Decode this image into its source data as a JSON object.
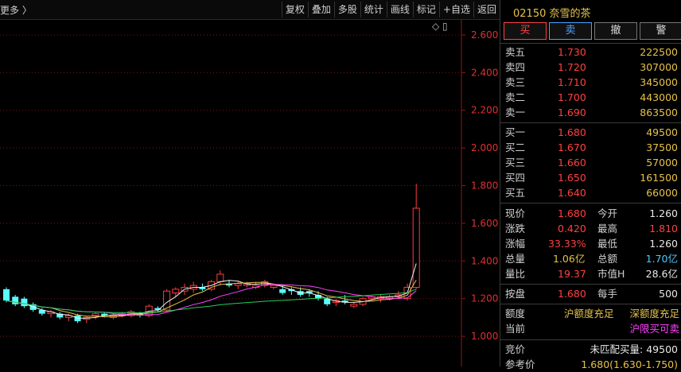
{
  "toolbar": {
    "more": "更多 〉",
    "buttons": [
      "复权",
      "叠加",
      "多股",
      "统计",
      "画线",
      "标记",
      "+自选",
      "返回"
    ]
  },
  "chart_icons": "◇ ▯",
  "chart_data": {
    "type": "candlestick",
    "y_ticks": [
      "2.600",
      "2.400",
      "2.200",
      "2.000",
      "1.800",
      "1.600",
      "1.400",
      "1.200",
      "1.000"
    ],
    "y_range": [
      0.84,
      2.68
    ],
    "candles": [
      {
        "o": 1.25,
        "h": 1.26,
        "l": 1.18,
        "c": 1.19
      },
      {
        "o": 1.21,
        "h": 1.22,
        "l": 1.16,
        "c": 1.17
      },
      {
        "o": 1.2,
        "h": 1.21,
        "l": 1.15,
        "c": 1.16
      },
      {
        "o": 1.17,
        "h": 1.18,
        "l": 1.13,
        "c": 1.14
      },
      {
        "o": 1.14,
        "h": 1.15,
        "l": 1.11,
        "c": 1.12
      },
      {
        "o": 1.12,
        "h": 1.14,
        "l": 1.1,
        "c": 1.13
      },
      {
        "o": 1.12,
        "h": 1.13,
        "l": 1.09,
        "c": 1.1
      },
      {
        "o": 1.1,
        "h": 1.12,
        "l": 1.08,
        "c": 1.11
      },
      {
        "o": 1.11,
        "h": 1.12,
        "l": 1.07,
        "c": 1.08
      },
      {
        "o": 1.09,
        "h": 1.11,
        "l": 1.07,
        "c": 1.1
      },
      {
        "o": 1.11,
        "h": 1.13,
        "l": 1.09,
        "c": 1.12
      },
      {
        "o": 1.12,
        "h": 1.13,
        "l": 1.1,
        "c": 1.11
      },
      {
        "o": 1.1,
        "h": 1.12,
        "l": 1.09,
        "c": 1.11
      },
      {
        "o": 1.11,
        "h": 1.13,
        "l": 1.1,
        "c": 1.12
      },
      {
        "o": 1.11,
        "h": 1.14,
        "l": 1.1,
        "c": 1.13
      },
      {
        "o": 1.12,
        "h": 1.13,
        "l": 1.1,
        "c": 1.11
      },
      {
        "o": 1.11,
        "h": 1.17,
        "l": 1.1,
        "c": 1.16
      },
      {
        "o": 1.15,
        "h": 1.16,
        "l": 1.13,
        "c": 1.14
      },
      {
        "o": 1.14,
        "h": 1.25,
        "l": 1.13,
        "c": 1.24
      },
      {
        "o": 1.23,
        "h": 1.26,
        "l": 1.21,
        "c": 1.25
      },
      {
        "o": 1.24,
        "h": 1.28,
        "l": 1.22,
        "c": 1.26
      },
      {
        "o": 1.25,
        "h": 1.29,
        "l": 1.23,
        "c": 1.27
      },
      {
        "o": 1.26,
        "h": 1.28,
        "l": 1.24,
        "c": 1.25
      },
      {
        "o": 1.25,
        "h": 1.3,
        "l": 1.24,
        "c": 1.29
      },
      {
        "o": 1.29,
        "h": 1.35,
        "l": 1.27,
        "c": 1.33
      },
      {
        "o": 1.28,
        "h": 1.3,
        "l": 1.26,
        "c": 1.27
      },
      {
        "o": 1.27,
        "h": 1.29,
        "l": 1.25,
        "c": 1.28
      },
      {
        "o": 1.27,
        "h": 1.29,
        "l": 1.26,
        "c": 1.28
      },
      {
        "o": 1.26,
        "h": 1.29,
        "l": 1.25,
        "c": 1.27
      },
      {
        "o": 1.27,
        "h": 1.3,
        "l": 1.26,
        "c": 1.29
      },
      {
        "o": 1.26,
        "h": 1.28,
        "l": 1.25,
        "c": 1.27
      },
      {
        "o": 1.25,
        "h": 1.27,
        "l": 1.22,
        "c": 1.23
      },
      {
        "o": 1.25,
        "h": 1.26,
        "l": 1.22,
        "c": 1.24
      },
      {
        "o": 1.24,
        "h": 1.26,
        "l": 1.21,
        "c": 1.22
      },
      {
        "o": 1.24,
        "h": 1.25,
        "l": 1.21,
        "c": 1.23
      },
      {
        "o": 1.22,
        "h": 1.24,
        "l": 1.19,
        "c": 1.2
      },
      {
        "o": 1.2,
        "h": 1.21,
        "l": 1.16,
        "c": 1.17
      },
      {
        "o": 1.18,
        "h": 1.2,
        "l": 1.16,
        "c": 1.19
      },
      {
        "o": 1.19,
        "h": 1.22,
        "l": 1.17,
        "c": 1.18
      },
      {
        "o": 1.16,
        "h": 1.18,
        "l": 1.15,
        "c": 1.17
      },
      {
        "o": 1.17,
        "h": 1.21,
        "l": 1.16,
        "c": 1.2
      },
      {
        "o": 1.2,
        "h": 1.22,
        "l": 1.19,
        "c": 1.21
      },
      {
        "o": 1.2,
        "h": 1.22,
        "l": 1.18,
        "c": 1.21
      },
      {
        "o": 1.2,
        "h": 1.22,
        "l": 1.19,
        "c": 1.21
      },
      {
        "o": 1.21,
        "h": 1.24,
        "l": 1.2,
        "c": 1.22
      },
      {
        "o": 1.2,
        "h": 1.28,
        "l": 1.19,
        "c": 1.26
      },
      {
        "o": 1.26,
        "h": 1.81,
        "l": 1.25,
        "c": 1.68
      }
    ],
    "ma_colors": [
      "#f0f0f0",
      "#e6c24a",
      "#ff44ff",
      "#22d05a"
    ]
  },
  "stock": {
    "code": "02150",
    "name": "奈雪的茶"
  },
  "trade_buttons": [
    "买",
    "卖",
    "撤",
    "警"
  ],
  "asks": [
    {
      "label": "卖五",
      "price": "1.730",
      "vol": "222500"
    },
    {
      "label": "卖四",
      "price": "1.720",
      "vol": "307000"
    },
    {
      "label": "卖三",
      "price": "1.710",
      "vol": "345000"
    },
    {
      "label": "卖二",
      "price": "1.700",
      "vol": "443000"
    },
    {
      "label": "卖一",
      "price": "1.690",
      "vol": "863500"
    }
  ],
  "bids": [
    {
      "label": "买一",
      "price": "1.680",
      "vol": "49500"
    },
    {
      "label": "买二",
      "price": "1.670",
      "vol": "37500"
    },
    {
      "label": "买三",
      "price": "1.660",
      "vol": "57000"
    },
    {
      "label": "买四",
      "price": "1.650",
      "vol": "161500"
    },
    {
      "label": "买五",
      "price": "1.640",
      "vol": "66000"
    }
  ],
  "quote": [
    {
      "l1": "现价",
      "v1": "1.680",
      "l2": "今开",
      "v2": "1.260"
    },
    {
      "l1": "涨跌",
      "v1": "0.420",
      "l2": "最高",
      "v2": "1.810"
    },
    {
      "l1": "涨幅",
      "v1": "33.33%",
      "l2": "最低",
      "v2": "1.260"
    },
    {
      "l1": "总量",
      "v1": "1.06亿",
      "l2": "总额",
      "v2": "1.70亿"
    },
    {
      "l1": "量比",
      "v1": "19.37",
      "l2": "市值H",
      "v2": "28.6亿"
    }
  ],
  "lot": {
    "l1": "按盘",
    "v1": "1.680",
    "l2": "每手",
    "v2": "500"
  },
  "quota": {
    "label": "额度",
    "sh": "沪额度充足",
    "sz": "深额度充足"
  },
  "current": {
    "label": "当前",
    "value": "沪限买可卖"
  },
  "auction": {
    "label": "竞价",
    "value": "未匹配买量: 49500"
  },
  "ref_price": {
    "label": "参考价",
    "value": "1.680(1.630-1.750)"
  }
}
